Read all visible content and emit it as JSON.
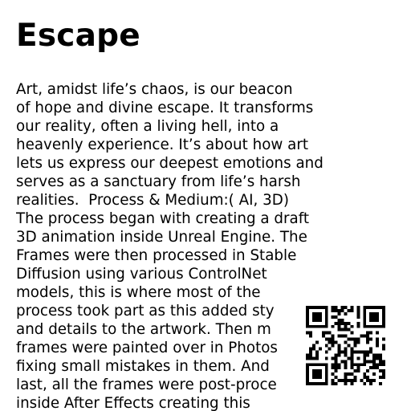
{
  "title": "Escape",
  "body": {
    "lines": [
      "Art, amidst life’s chaos, is our beacon",
      "of hope and divine escape. It transforms",
      "our reality, often a living hell, into a",
      "heavenly experience. It’s about how art",
      "lets us express our deepest emotions and",
      "serves as a sanctuary from life’s harsh",
      "realities.  Process & Medium:( AI, 3D)",
      "The process began with creating a draft",
      "3D animation inside Unreal Engine. The",
      "Frames were then processed in Stable",
      "Diffusion using various ControlNet",
      "models, this is where most of the",
      "process took part as this added sty",
      "and details to the artwork. Then m",
      "frames were painted over in Photos",
      "fixing small mistakes in them. And",
      "last, all the frames were post-proce",
      "inside After Effects creating this"
    ]
  }
}
